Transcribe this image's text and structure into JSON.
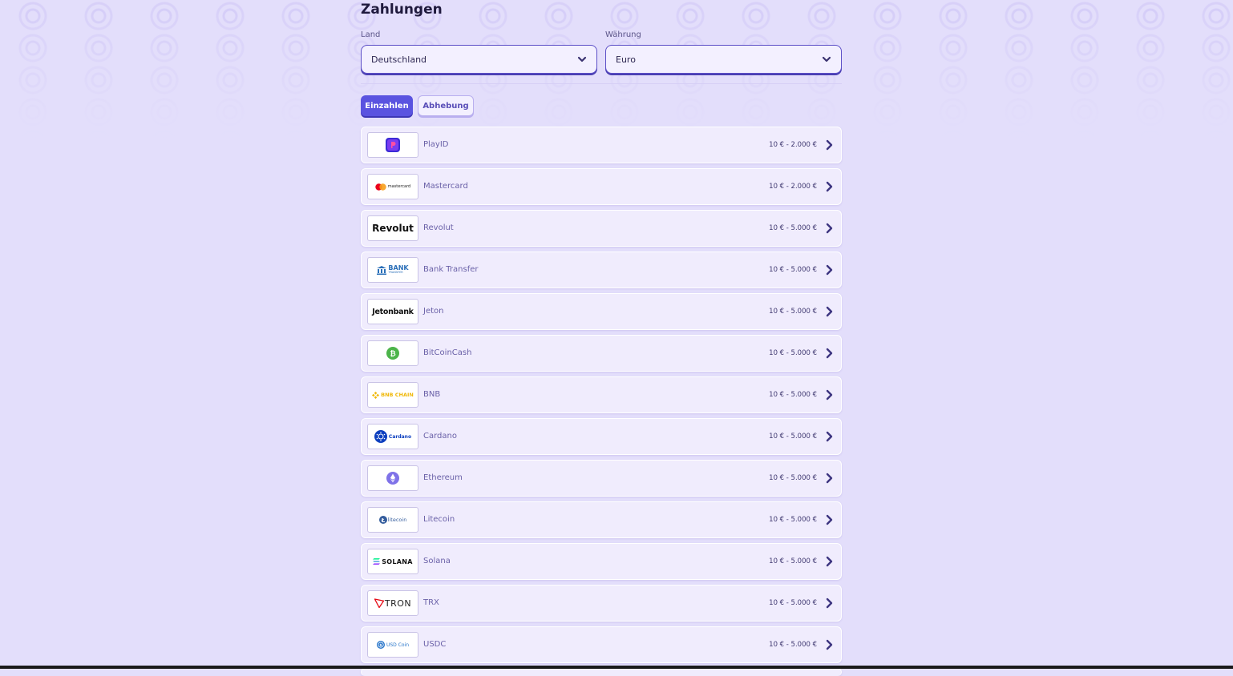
{
  "page": {
    "title": "Zahlungen"
  },
  "filters": {
    "country": {
      "label": "Land",
      "value": "Deutschland"
    },
    "currency": {
      "label": "Währung",
      "value": "Euro"
    }
  },
  "tabs": [
    {
      "label": "Einzahlen",
      "active": true
    },
    {
      "label": "Abhebung",
      "active": false
    }
  ],
  "logos": {
    "mastercard": "mastercard",
    "revolut": "Revolut",
    "bank_line1": "BANK",
    "bank_line2": "TRANSFER",
    "jeton": "Jetonbank",
    "bnb": "BNB CHAIN",
    "cardano": "Cardano",
    "litecoin": "litecoin",
    "solana": "SOLANA",
    "tron": "TRON",
    "usdc": "USD Coin"
  },
  "methods": [
    {
      "name": "PlayID",
      "range": "10 € - 2.000 €",
      "icon": "playid-logo-icon"
    },
    {
      "name": "Mastercard",
      "range": "10 € - 2.000 €",
      "icon": "mastercard-logo-icon"
    },
    {
      "name": "Revolut",
      "range": "10 € - 5.000 €",
      "icon": "revolut-logo-icon"
    },
    {
      "name": "Bank Transfer",
      "range": "10 € - 5.000 €",
      "icon": "bank-transfer-logo-icon"
    },
    {
      "name": "Jeton",
      "range": "10 € - 5.000 €",
      "icon": "jetonbank-logo-icon"
    },
    {
      "name": "BitCoinCash",
      "range": "10 € - 5.000 €",
      "icon": "bitcoincash-logo-icon"
    },
    {
      "name": "BNB",
      "range": "10 € - 5.000 €",
      "icon": "bnb-chain-logo-icon"
    },
    {
      "name": "Cardano",
      "range": "10 € - 5.000 €",
      "icon": "cardano-logo-icon"
    },
    {
      "name": "Ethereum",
      "range": "10 € - 5.000 €",
      "icon": "ethereum-logo-icon"
    },
    {
      "name": "Litecoin",
      "range": "10 € - 5.000 €",
      "icon": "litecoin-logo-icon"
    },
    {
      "name": "Solana",
      "range": "10 € - 5.000 €",
      "icon": "solana-logo-icon"
    },
    {
      "name": "TRX",
      "range": "10 € - 5.000 €",
      "icon": "tron-logo-icon"
    },
    {
      "name": "USDC",
      "range": "10 € - 5.000 €",
      "icon": "usdc-logo-icon"
    }
  ],
  "colors": {
    "accent": "#5a53e0",
    "background": "#e3defb",
    "row": "#f0ecfd"
  }
}
